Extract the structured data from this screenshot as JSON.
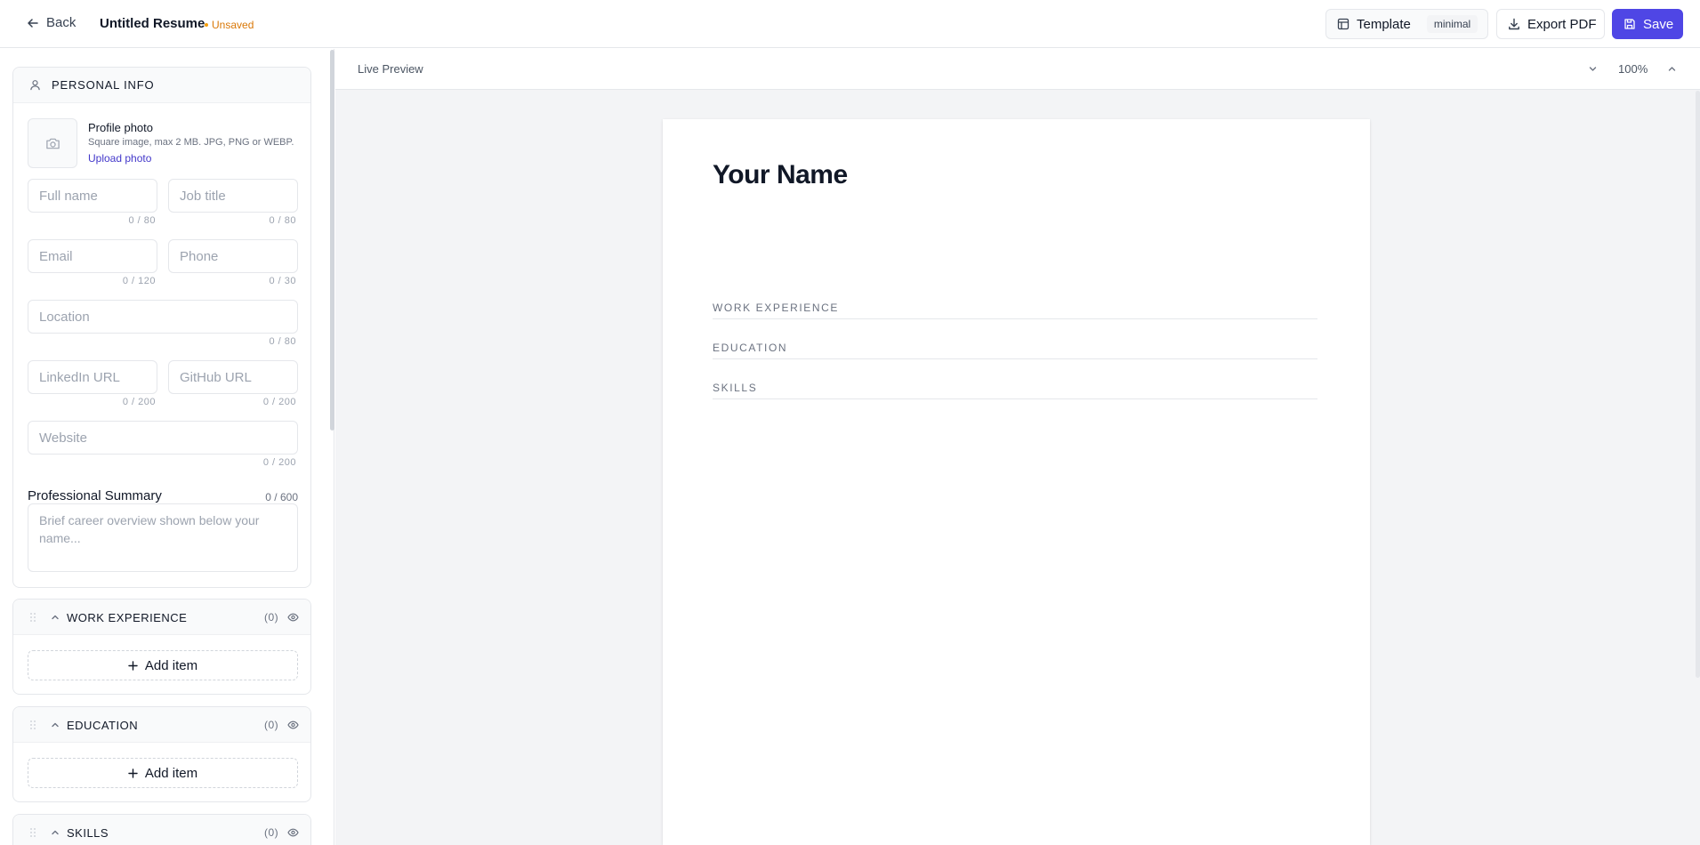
{
  "header": {
    "back_label": "Back",
    "doc_title": "Untitled Resume",
    "status": "Unsaved",
    "template_label": "Template",
    "template_value": "minimal",
    "export_label": "Export PDF",
    "save_label": "Save",
    "accent_color": "#4f46e5",
    "status_color": "#d97706"
  },
  "personal": {
    "title": "PERSONAL INFO",
    "photo_label": "Profile photo",
    "photo_hint": "Square image, max 2 MB. JPG, PNG or WEBP.",
    "photo_upload": "Upload photo",
    "fields": {
      "full_name": {
        "placeholder": "Full name",
        "count": "0 / 80"
      },
      "job_title": {
        "placeholder": "Job title",
        "count": "0 / 80"
      },
      "email": {
        "placeholder": "Email",
        "count": "0 / 120"
      },
      "phone": {
        "placeholder": "Phone",
        "count": "0 / 30"
      },
      "location": {
        "placeholder": "Location",
        "count": "0 / 80"
      },
      "linkedin": {
        "placeholder": "LinkedIn URL",
        "count": "0 / 200"
      },
      "github": {
        "placeholder": "GitHub URL",
        "count": "0 / 200"
      },
      "website": {
        "placeholder": "Website",
        "count": "0 / 200"
      }
    },
    "summary_label": "Professional Summary",
    "summary_count": "0 / 600",
    "summary_placeholder": "Brief career overview shown below your name..."
  },
  "sections": [
    {
      "label": "WORK EXPERIENCE",
      "count": "(0)",
      "add_label": "Add item"
    },
    {
      "label": "EDUCATION",
      "count": "(0)",
      "add_label": "Add item"
    },
    {
      "label": "SKILLS",
      "count": "(0)"
    }
  ],
  "preview": {
    "title": "Live Preview",
    "zoom": "100%",
    "resume": {
      "name": "Your Name",
      "sections": [
        "WORK EXPERIENCE",
        "EDUCATION",
        "SKILLS"
      ]
    }
  }
}
